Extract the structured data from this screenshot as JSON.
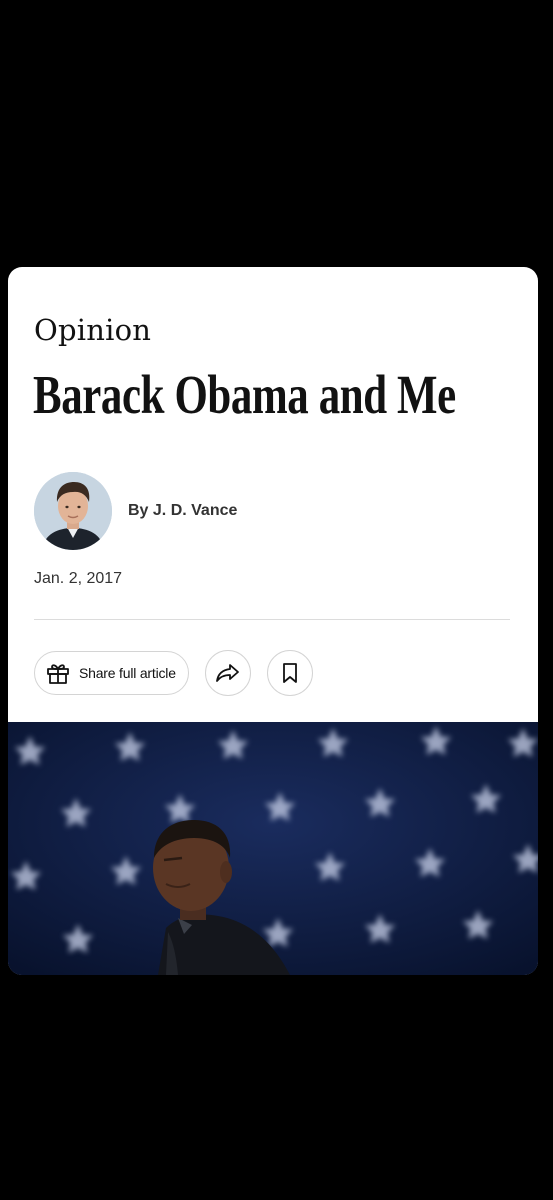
{
  "article": {
    "section": "Opinion",
    "headline": "Barack Obama and Me",
    "byline": "By J. D. Vance",
    "date": "Jan. 2, 2017"
  },
  "actions": {
    "share_full_label": "Share full article",
    "share_icon": "share-arrow-icon",
    "save_icon": "bookmark-icon",
    "gift_icon": "gift-icon"
  },
  "colors": {
    "background": "#000000",
    "card": "#ffffff",
    "text": "#121212",
    "hero_navy": "#0d1a3d"
  }
}
